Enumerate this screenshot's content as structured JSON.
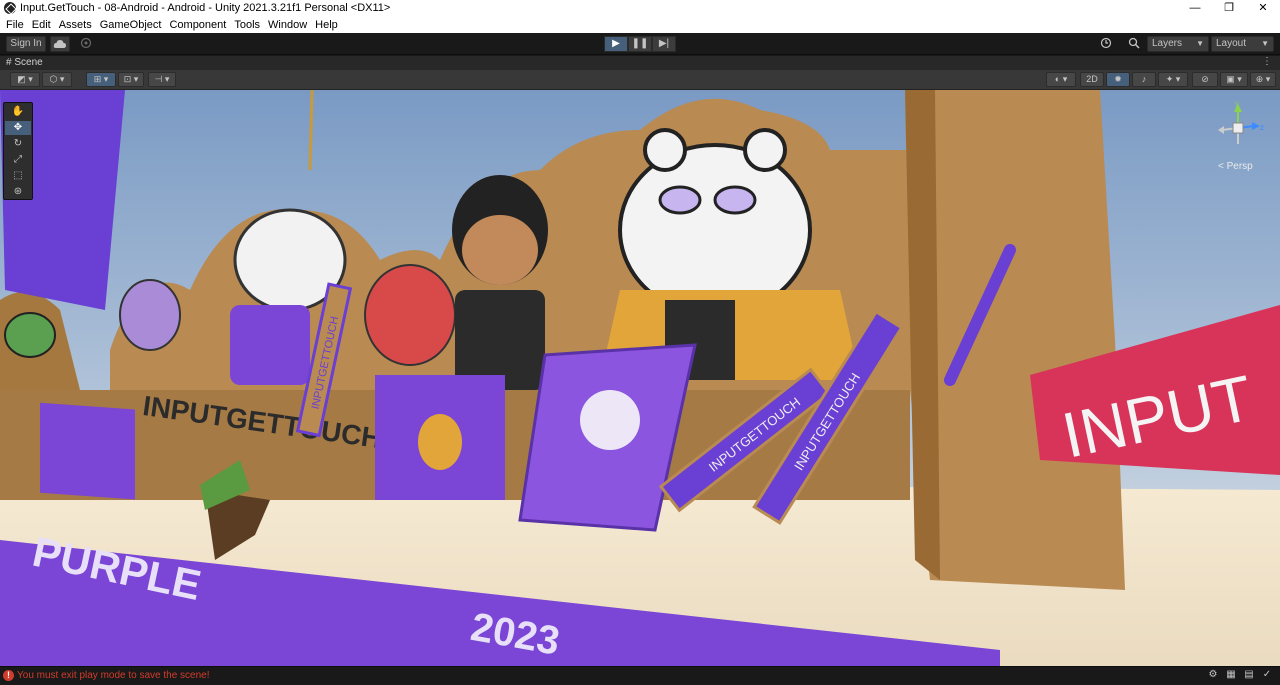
{
  "window": {
    "title": "Input.GetTouch - 08-Android - Android - Unity 2021.3.21f1 Personal <DX11>",
    "controls": {
      "minimize": "—",
      "maximize": "❐",
      "close": "✕"
    }
  },
  "menu": [
    "File",
    "Edit",
    "Assets",
    "GameObject",
    "Component",
    "Tools",
    "Window",
    "Help"
  ],
  "toolbar": {
    "sign_in": "Sign In",
    "play_glyph": "▶",
    "pause_glyph": "❚❚",
    "step_glyph": "▶|",
    "layers_label": "Layers",
    "layout_label": "Layout"
  },
  "scene": {
    "tab_label": "Scene",
    "toggle_2d": "2D",
    "persp_label": "< Persp",
    "gizmo_axes": {
      "y": "y",
      "z": "z"
    }
  },
  "world_text": {
    "sign_in_banner": "INPUT",
    "floor_text_a": "PURPLE",
    "floor_text_year": "2023",
    "wall_text": "INPUTGETTOUCH",
    "plank_text_1": "INPUTGETTOUCH",
    "plank_text_2": "INPUTGETTOUCH",
    "plank_text_3": "INPUTGETTOUCH"
  },
  "status": {
    "message": "You must exit play mode to save the scene!"
  },
  "colors": {
    "purple": "#7b45d6",
    "cardboard": "#b98a52",
    "sky": "#93afd0",
    "floor": "#f0e3cb",
    "error": "#d23c2c",
    "active_blue": "#46607c"
  },
  "icons": [
    "unity-logo-icon",
    "cloud-icon",
    "collab-icon",
    "history-icon",
    "search-icon",
    "hand-tool-icon",
    "move-tool-icon",
    "rotate-tool-icon",
    "scale-tool-icon",
    "rect-tool-icon",
    "transform-tool-icon",
    "error-icon"
  ]
}
